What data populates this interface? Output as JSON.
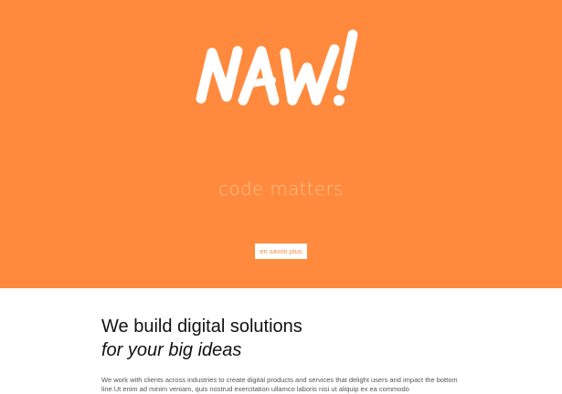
{
  "theme": {
    "hero_bg": "#ff8a3d",
    "accent": "#ff8a3d",
    "logo_color": "#ffffff",
    "tagline_color": "#ffc08e",
    "content_bg": "#ffffff",
    "text_color": "#111111"
  },
  "hero": {
    "logo_text": "NAW!",
    "tagline": "code matters",
    "cta_label": "en savoir plus"
  },
  "content": {
    "heading": "We build digital solutions",
    "subheading": "for your big ideas",
    "body": "We work with clients across industries to create digital products and services that delight users and impact the bottom line.Ut enim ad minim veniam, quis nostrud exercitation ullamco laboris nisi ut aliquip ex ea commodo"
  }
}
